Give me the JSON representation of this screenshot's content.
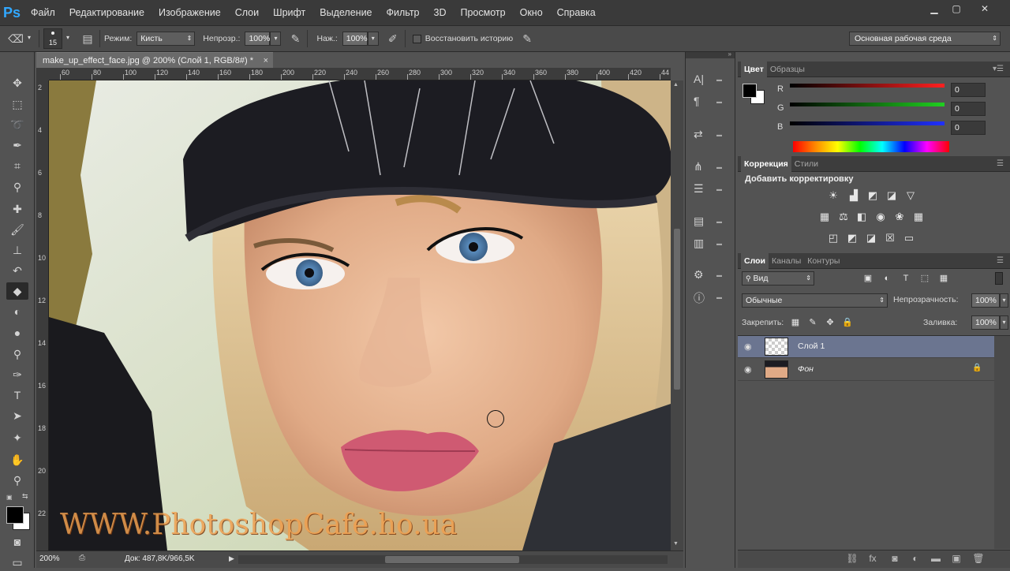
{
  "menubar": {
    "logo": "Ps",
    "items": [
      "Файл",
      "Редактирование",
      "Изображение",
      "Слои",
      "Шрифт",
      "Выделение",
      "Фильтр",
      "3D",
      "Просмотр",
      "Окно",
      "Справка"
    ],
    "minimize_icon": "minimize-icon",
    "restore_icon": "restore-icon",
    "close_icon": "close-icon"
  },
  "options": {
    "brush_size": "15",
    "mode_label": "Режим:",
    "mode_value": "Кисть",
    "opacity_label": "Непрозр.:",
    "opacity_value": "100%",
    "pressure_label": "Наж.:",
    "pressure_value": "100%",
    "restore_history_label": "Восстановить историю",
    "workspace": "Основная рабочая среда"
  },
  "document": {
    "tab_title": "make_up_effect_face.jpg @ 200% (Слой 1, RGB/8#) *",
    "close_symbol": "×",
    "ruler_top": [
      "60",
      "80",
      "100",
      "120",
      "140",
      "160",
      "180",
      "200",
      "220",
      "240",
      "260",
      "280",
      "300",
      "320",
      "340",
      "360",
      "380",
      "400",
      "420",
      "44"
    ],
    "ruler_left": [
      "2",
      "4",
      "6",
      "8",
      "10",
      "12",
      "14",
      "16",
      "18",
      "20",
      "22"
    ],
    "watermark": "WWW.PhotoshopCafe.ho.ua",
    "zoom": "200%",
    "doc_size": "Док: 487,8K/966,5K"
  },
  "color_panel": {
    "tabs": [
      "Цвет",
      "Образцы"
    ],
    "channels": [
      {
        "label": "R",
        "value": "0",
        "color": "#ff2020"
      },
      {
        "label": "G",
        "value": "0",
        "color": "#20d020"
      },
      {
        "label": "B",
        "value": "0",
        "color": "#2030ff"
      }
    ],
    "foreground": "#000000",
    "background": "#ffffff"
  },
  "adjustments_panel": {
    "tabs": [
      "Коррекция",
      "Стили"
    ],
    "title": "Добавить корректировку"
  },
  "layers_panel": {
    "tabs": [
      "Слои",
      "Каналы",
      "Контуры"
    ],
    "filter_kind": "Вид",
    "blend_mode": "Обычные",
    "opacity_label": "Непрозрачность:",
    "opacity_value": "100%",
    "lock_label": "Закрепить:",
    "fill_label": "Заливка:",
    "fill_value": "100%",
    "layers": [
      {
        "name": "Слой 1",
        "selected": true,
        "locked": false
      },
      {
        "name": "Фон",
        "selected": false,
        "locked": true
      }
    ]
  },
  "colors": {
    "menubar_bg": "#3a3a3a",
    "panel_bg": "#535353",
    "selected_layer": "#6b7590",
    "accent_logo": "#31a8ff"
  }
}
